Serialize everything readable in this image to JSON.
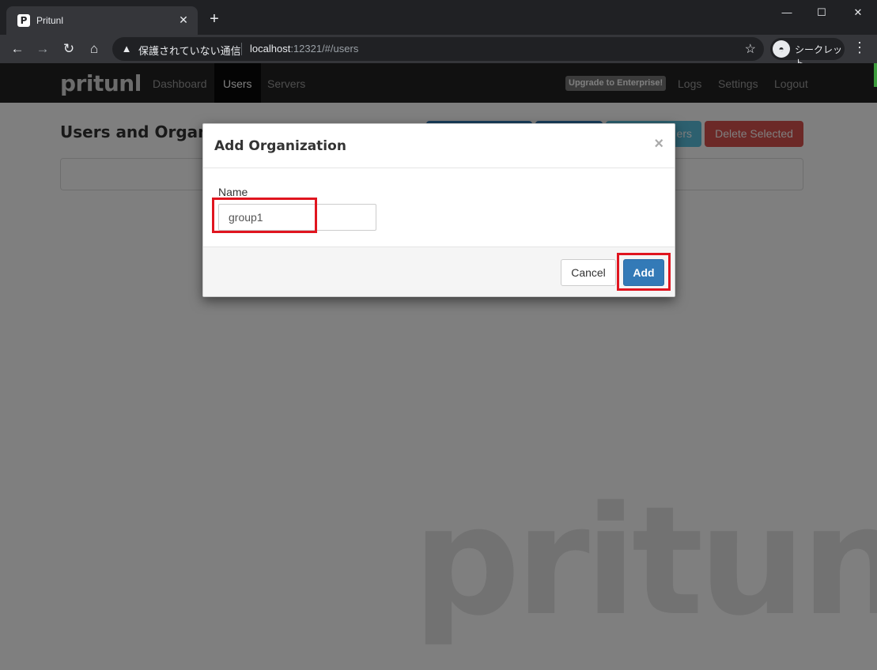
{
  "browser": {
    "tab_title": "Pritunl",
    "tab_favicon": "P",
    "security_warning": "保護されていない通信",
    "url_host": "localhost",
    "url_rest": ":12321/#/users",
    "incognito_label": "シークレット"
  },
  "navbar": {
    "brand": "pritunl",
    "links": [
      "Dashboard",
      "Users",
      "Servers"
    ],
    "active_link": "Users",
    "upgrade_badge": "Upgrade to Enterprise!",
    "right_links": [
      "Logs",
      "Settings",
      "Logout"
    ]
  },
  "page": {
    "title": "Users and Organizations",
    "title_visible": "Users and Organi",
    "buttons_visible_text": [
      "ers",
      "Delete Selected"
    ],
    "watermark": "pritunl"
  },
  "modal": {
    "title": "Add Organization",
    "close_glyph": "×",
    "name_label": "Name",
    "name_value": "group1",
    "cancel_label": "Cancel",
    "add_label": "Add"
  },
  "colors": {
    "primary": "#337ab7",
    "danger": "#d9534f",
    "navbar": "#222222",
    "highlight": "#e0151f"
  },
  "icons": [
    "back-icon",
    "forward-icon",
    "reload-icon",
    "home-icon",
    "warning-icon",
    "star-icon",
    "incognito-icon",
    "kebab-menu-icon",
    "close-icon",
    "plus-icon",
    "minimize-icon",
    "maximize-icon"
  ]
}
